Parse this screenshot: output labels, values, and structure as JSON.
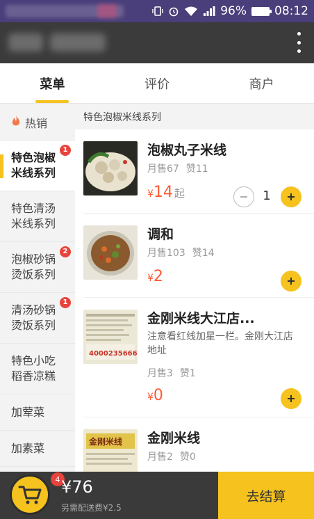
{
  "status_bar": {
    "battery": "96%",
    "time": "08:12"
  },
  "tabs": [
    "菜单",
    "评价",
    "商户"
  ],
  "sidebar": {
    "hot_label": "热销",
    "items": [
      {
        "label": "特色泡椒米线系列",
        "badge": "1"
      },
      {
        "label": "特色清汤米线系列",
        "badge": ""
      },
      {
        "label": "泡椒砂锅烫饭系列",
        "badge": "2"
      },
      {
        "label": "清汤砂锅烫饭系列",
        "badge": "1"
      },
      {
        "label": "特色小吃稻香凉糕",
        "badge": ""
      },
      {
        "label": "加荤菜",
        "badge": ""
      },
      {
        "label": "加素菜",
        "badge": ""
      }
    ]
  },
  "category_title": "特色泡椒米线系列",
  "products": [
    {
      "name": "泡椒丸子米线",
      "sold": "月售67",
      "likes": "赞11",
      "currency": "¥",
      "price": "14",
      "price_suffix": "起",
      "qty": "1"
    },
    {
      "name": "调和",
      "sold": "月售103",
      "likes": "赞14",
      "currency": "¥",
      "price": "2"
    },
    {
      "name": "金刚米线大江店...",
      "desc": "注意看红线加星一栏。金刚大江店地址",
      "sold": "月售3",
      "likes": "赞1",
      "currency": "¥",
      "price": "0",
      "thumb_text": "4000235666"
    },
    {
      "name": "金刚米线",
      "sold": "月售2",
      "likes": "赞0",
      "thumb_text": "金刚米线"
    }
  ],
  "cart": {
    "count": "4",
    "total": "¥76",
    "delivery_note": "另需配送费¥2.5",
    "checkout_label": "去结算"
  },
  "colors": {
    "accent": "#f5c21e",
    "price": "#ff5a36",
    "badge": "#e8433c"
  }
}
